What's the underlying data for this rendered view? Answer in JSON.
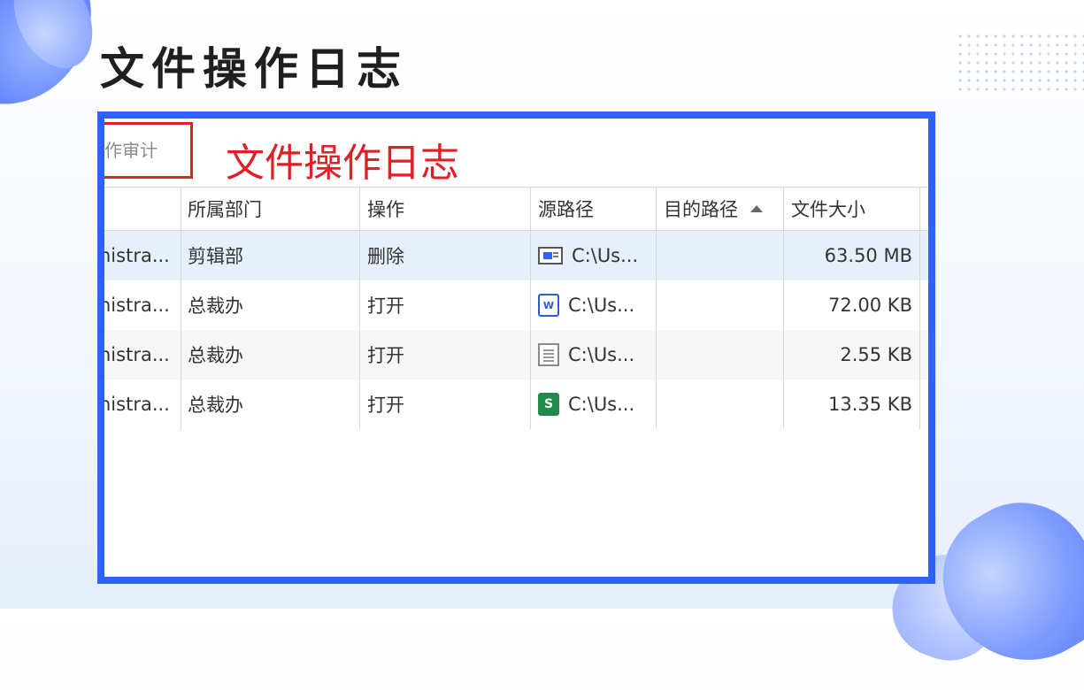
{
  "slide": {
    "title": "文件操作日志"
  },
  "audit_tab": {
    "label": "操作审计"
  },
  "overlay_label": "文件操作日志",
  "table": {
    "columns": {
      "dept": "所属部门",
      "op": "操作",
      "src": "源路径",
      "dst": "目的路径",
      "size": "文件大小"
    },
    "sort": {
      "column": "目的路径",
      "direction": "ascending"
    },
    "rows": [
      {
        "user": "nistra...",
        "dept": "剪辑部",
        "op": "删除",
        "icon": "video-file-icon",
        "src": "C:\\Us...",
        "dst": "",
        "size": "63.50 MB",
        "selected": true
      },
      {
        "user": "nistra...",
        "dept": "总裁办",
        "op": "打开",
        "icon": "word-file-icon",
        "src": "C:\\Us...",
        "dst": "",
        "size": "72.00 KB",
        "selected": false
      },
      {
        "user": "nistra...",
        "dept": "总裁办",
        "op": "打开",
        "icon": "text-file-icon",
        "src": "C:\\Us...",
        "dst": "",
        "size": "2.55 KB",
        "selected": false
      },
      {
        "user": "nistra...",
        "dept": "总裁办",
        "op": "打开",
        "icon": "spreadsheet-file-icon",
        "src": "C:\\Us...",
        "dst": "",
        "size": "13.35 KB",
        "selected": false
      }
    ]
  },
  "colors": {
    "frame": "#2e63f6",
    "highlight": "#e01f26",
    "selected_row": "#e6f0fb"
  }
}
